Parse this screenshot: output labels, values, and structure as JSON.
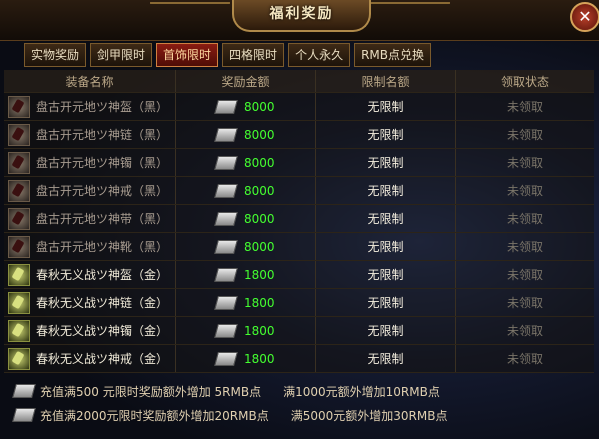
{
  "window": {
    "title": "福利奖励",
    "close_label": "✕"
  },
  "tabs": [
    {
      "label": "实物奖励"
    },
    {
      "label": "剑甲限时"
    },
    {
      "label": "首饰限时"
    },
    {
      "label": "四格限时"
    },
    {
      "label": "个人永久"
    },
    {
      "label": "RMB点兑换"
    }
  ],
  "active_tab": 2,
  "table": {
    "headers": [
      "装备名称",
      "奖励金额",
      "限制名额",
      "领取状态"
    ],
    "rows": [
      {
        "name": "盘古开元地ツ神盔（黑）",
        "amount": "8000",
        "limit": "无限制",
        "status": "未领取",
        "tier": "black"
      },
      {
        "name": "盘古开元地ツ神链（黑）",
        "amount": "8000",
        "limit": "无限制",
        "status": "未领取",
        "tier": "black"
      },
      {
        "name": "盘古开元地ツ神镯（黑）",
        "amount": "8000",
        "limit": "无限制",
        "status": "未领取",
        "tier": "black"
      },
      {
        "name": "盘古开元地ツ神戒（黑）",
        "amount": "8000",
        "limit": "无限制",
        "status": "未领取",
        "tier": "black"
      },
      {
        "name": "盘古开元地ツ神带（黑）",
        "amount": "8000",
        "limit": "无限制",
        "status": "未领取",
        "tier": "black"
      },
      {
        "name": "盘古开元地ツ神靴（黑）",
        "amount": "8000",
        "limit": "无限制",
        "status": "未领取",
        "tier": "black"
      },
      {
        "name": "春秋无义战ツ神盔（金）",
        "amount": "1800",
        "limit": "无限制",
        "status": "未领取",
        "tier": "gold"
      },
      {
        "name": "春秋无义战ツ神链（金）",
        "amount": "1800",
        "limit": "无限制",
        "status": "未领取",
        "tier": "gold"
      },
      {
        "name": "春秋无义战ツ神镯（金）",
        "amount": "1800",
        "limit": "无限制",
        "status": "未领取",
        "tier": "gold"
      },
      {
        "name": "春秋无义战ツ神戒（金）",
        "amount": "1800",
        "limit": "无限制",
        "status": "未领取",
        "tier": "gold"
      }
    ]
  },
  "footer": {
    "line1": {
      "part1": "充值满500 元限时奖励额外增加 5RMB点",
      "part2": "满1000元额外增加10RMB点"
    },
    "line2": {
      "part1": "充值满2000元限时奖励额外增加20RMB点",
      "part2": "满5000元额外增加30RMB点"
    }
  }
}
